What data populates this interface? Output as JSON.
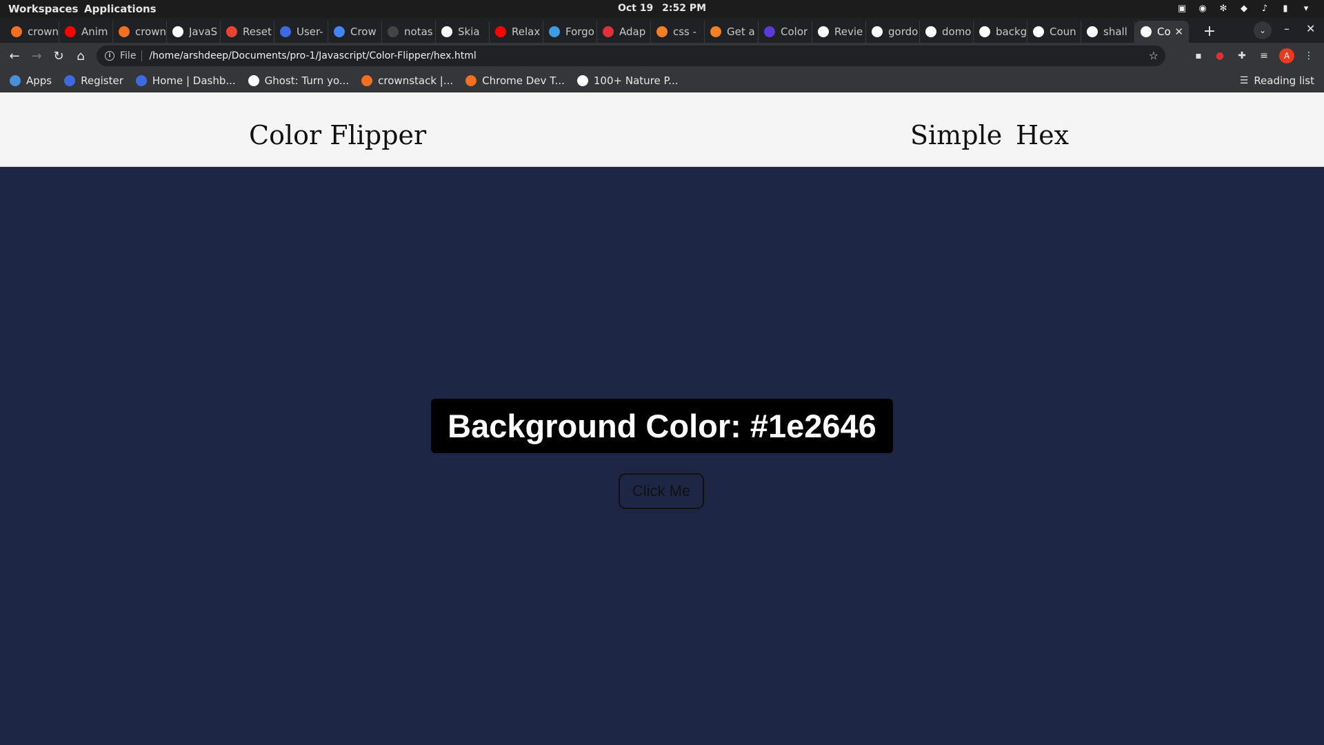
{
  "system_bar": {
    "workspaces": "Workspaces",
    "applications": "Applications",
    "date": "Oct 19",
    "time": "2:52 PM"
  },
  "tabs": [
    {
      "label": "crown",
      "favicon": "crownstack-icon",
      "color": "#f36f21"
    },
    {
      "label": "Anim",
      "favicon": "youtube-icon",
      "color": "#ff0000"
    },
    {
      "label": "crown",
      "favicon": "crownstack-icon",
      "color": "#f36f21"
    },
    {
      "label": "JavaS",
      "favicon": "bookmark-icon",
      "color": "#ffffff"
    },
    {
      "label": "Reset",
      "favicon": "gmail-icon",
      "color": "#ea4335"
    },
    {
      "label": "User-",
      "favicon": "k-icon",
      "color": "#3d6ae0"
    },
    {
      "label": "Crow",
      "favicon": "calendar-icon",
      "color": "#4285f4"
    },
    {
      "label": "notas",
      "favicon": "github-icon",
      "color": "#444444"
    },
    {
      "label": "Skia",
      "favicon": "globe-icon",
      "color": "#ffffff"
    },
    {
      "label": "Relax",
      "favicon": "youtube-icon",
      "color": "#ff0000"
    },
    {
      "label": "Forgo",
      "favicon": "k-icon",
      "color": "#3d9be0"
    },
    {
      "label": "Adap",
      "favicon": "asterisk-icon",
      "color": "#e0313a"
    },
    {
      "label": "css -",
      "favicon": "stackoverflow-icon",
      "color": "#f48024"
    },
    {
      "label": "Get a",
      "favicon": "stackoverflow-icon",
      "color": "#f48024"
    },
    {
      "label": "Color",
      "favicon": "c-icon",
      "color": "#5a3bd8"
    },
    {
      "label": "Revie",
      "favicon": "globe-icon",
      "color": "#ffffff"
    },
    {
      "label": "gordo",
      "favicon": "google-icon",
      "color": "#ffffff"
    },
    {
      "label": "domo",
      "favicon": "google-icon",
      "color": "#ffffff"
    },
    {
      "label": "backg",
      "favicon": "google-icon",
      "color": "#ffffff"
    },
    {
      "label": "Coun",
      "favicon": "globe-icon",
      "color": "#ffffff"
    },
    {
      "label": "shall",
      "favicon": "google-icon",
      "color": "#ffffff"
    },
    {
      "label": "Co",
      "favicon": "globe-icon",
      "color": "#ffffff",
      "active": true
    }
  ],
  "toolbar": {
    "file_label": "File",
    "url": "/home/arshdeep/Documents/pro-1/Javascript/Color-Flipper/hex.html",
    "avatar_letter": "A"
  },
  "bookmarks": [
    {
      "label": "Apps",
      "icon": "apps-grid-icon"
    },
    {
      "label": "Register",
      "icon": "k-icon"
    },
    {
      "label": "Home | Dashb...",
      "icon": "k-icon"
    },
    {
      "label": "Ghost: Turn yo...",
      "icon": "ghost-icon"
    },
    {
      "label": "crownstack |...",
      "icon": "crownstack-icon"
    },
    {
      "label": "Chrome Dev T...",
      "icon": "crownstack-icon"
    },
    {
      "label": "100+ Nature P...",
      "icon": "unsplash-icon"
    }
  ],
  "reading_list": "Reading list",
  "page": {
    "brand": "Color Flipper",
    "nav": {
      "simple": "Simple",
      "hex": "Hex"
    },
    "color_label": "Background Color: #1e2646",
    "button_label": "Click Me",
    "background_color": "#1e2646"
  }
}
